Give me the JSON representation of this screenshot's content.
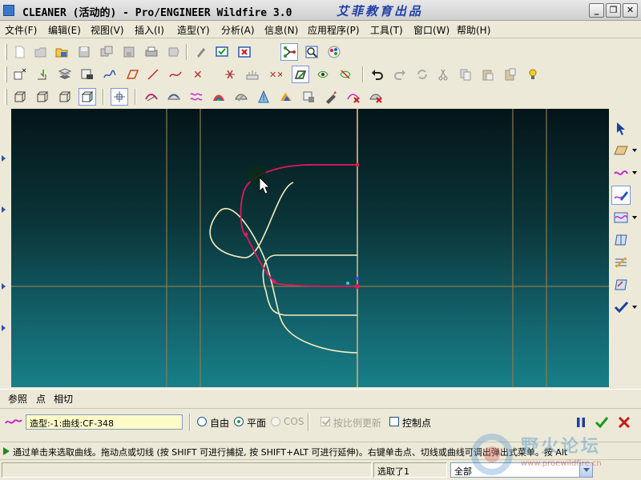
{
  "window": {
    "title": "CLEANER (活动的) - Pro/ENGINEER Wildfire 3.0",
    "brand": "艾菲教育出品",
    "minimize_glyph": "_",
    "restore_glyph": "❐",
    "close_glyph": "✕"
  },
  "menu": {
    "items": [
      {
        "label": "文件(F)"
      },
      {
        "label": "编辑(E)"
      },
      {
        "label": "视图(V)"
      },
      {
        "label": "插入(I)"
      },
      {
        "label": "造型(Y)"
      },
      {
        "label": "分析(A)"
      },
      {
        "label": "信息(N)"
      },
      {
        "label": "应用程序(P)"
      },
      {
        "label": "工具(T)"
      },
      {
        "label": "窗口(W)"
      },
      {
        "label": "帮助(H)"
      }
    ]
  },
  "toolbar": {
    "icons_row1": [
      "new-icon",
      "open-icon",
      "folder-icon",
      "save-icon",
      "save-copy-icon",
      "backup-icon",
      "print-icon",
      "send-icon",
      "pen-icon",
      "display-icon",
      "close-window-icon",
      "network-icon",
      "zoom-icon",
      "color-icon"
    ],
    "icons_row2": [
      "datum-point-icon",
      "move-icon",
      "layers-icon",
      "sketch-icon",
      "curve-icon",
      "plane-icon",
      "line-icon",
      "spline-icon",
      "points-icon",
      "trim-icon",
      "measure-icon",
      "scatter-icon",
      "active-icon",
      "eye-icon",
      "hide-icon",
      "undo-icon",
      "redo-icon",
      "regen-icon",
      "cut-icon",
      "copy-icon",
      "paste-icon",
      "paste-special-icon",
      "light-icon"
    ],
    "icons_row3": [
      "view-front-icon",
      "view-back-icon",
      "view-side-icon",
      "view-iso-icon",
      "grid-icon",
      "surface-icon",
      "boundary-icon",
      "wave-icon",
      "shade-icon",
      "reflect-icon",
      "draft-icon",
      "slope-icon",
      "section-icon",
      "brush-icon",
      "delete-curve-icon",
      "delete-surface-icon"
    ]
  },
  "right_toolbar": {
    "icons": [
      "select-arrow-icon",
      "sketch-plane-icon",
      "curve-wave-icon",
      "edit-curve-icon",
      "surface-wave-icon",
      "boundary-surface-icon",
      "connect-icon",
      "trim-surface-icon",
      "done-check-icon"
    ]
  },
  "dashboard": {
    "tabs": [
      {
        "label": "参照"
      },
      {
        "label": "点"
      },
      {
        "label": "相切"
      }
    ],
    "curve_field": "造型:-1:曲线:CF-348",
    "option_free": "自由",
    "option_plane": "平面",
    "option_cos": "COS",
    "check_update": "按比例更新",
    "check_ctrl": "控制点",
    "selected_option": "平面"
  },
  "message": {
    "text": "通过单击来选取曲线。拖动点或切线 (按 SHIFT 可进行捕捉, 按 SHIFT+ALT 可进行延伸)。右键单击点、切线或曲线可调出弹出式菜单。按 Alt"
  },
  "status": {
    "selected": "选取了1",
    "filter": "全部"
  },
  "watermark": {
    "text": "野火论坛",
    "url": "www.proewildfire.cn"
  },
  "colors": {
    "curve_red": "#e0195d",
    "curve_yellow": "#f5edbe",
    "grid_line": "#8d7a4a",
    "accent_blue": "#1f3fa8"
  }
}
